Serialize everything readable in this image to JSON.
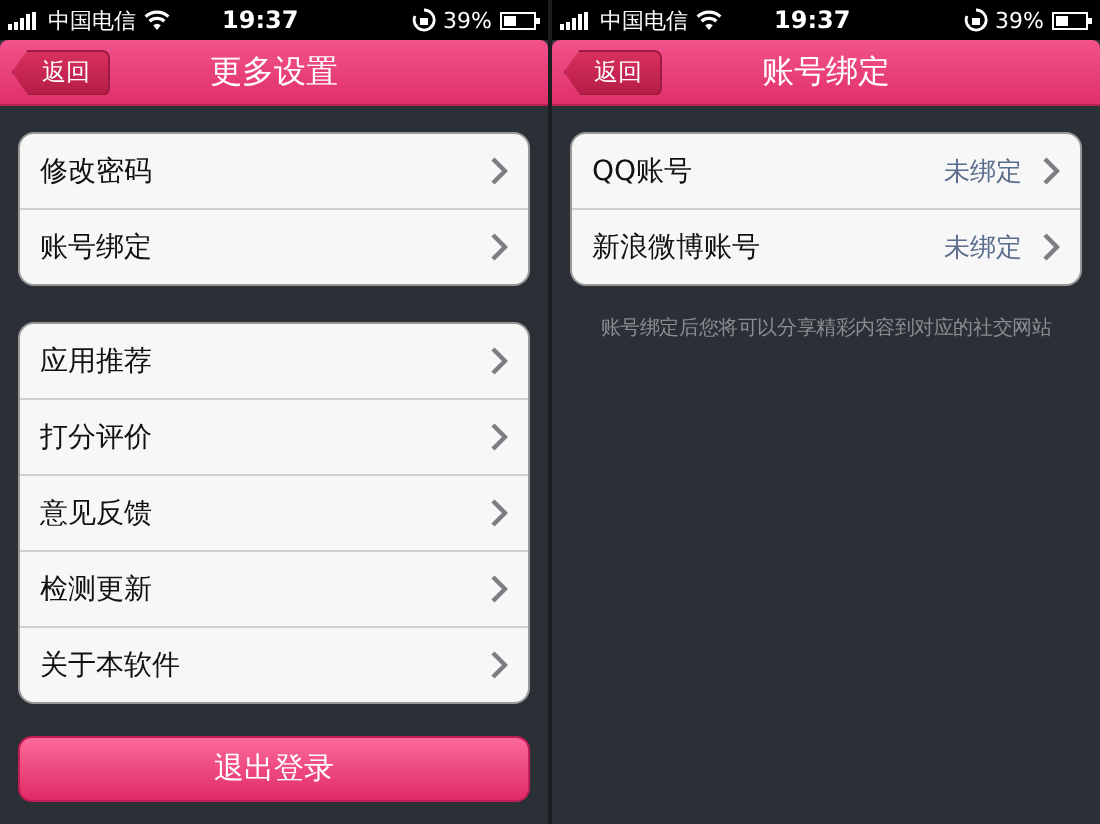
{
  "screens": [
    {
      "status_bar": {
        "carrier": "中国电信",
        "time": "19:37",
        "battery": "39%"
      },
      "nav": {
        "back": "返回",
        "title": "更多设置"
      },
      "groups": [
        [
          {
            "label": "修改密码"
          },
          {
            "label": "账号绑定"
          }
        ],
        [
          {
            "label": "应用推荐"
          },
          {
            "label": "打分评价"
          },
          {
            "label": "意见反馈"
          },
          {
            "label": "检测更新"
          },
          {
            "label": "关于本软件"
          }
        ]
      ],
      "button": "退出登录"
    },
    {
      "status_bar": {
        "carrier": "中国电信",
        "time": "19:37",
        "battery": "39%"
      },
      "nav": {
        "back": "返回",
        "title": "账号绑定"
      },
      "groups": [
        [
          {
            "label": "QQ账号",
            "value": "未绑定"
          },
          {
            "label": "新浪微博账号",
            "value": "未绑定"
          }
        ]
      ],
      "note": "账号绑定后您将可以分享精彩内容到对应的社交网站"
    }
  ]
}
